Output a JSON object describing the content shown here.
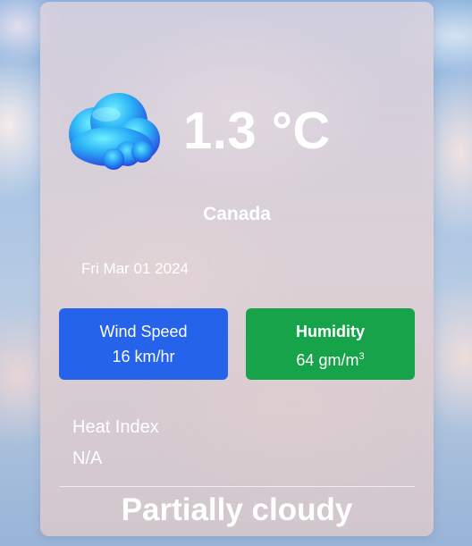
{
  "weather": {
    "temperature": "1.3 °C",
    "location": "Canada",
    "date": "Fri Mar 01 2024",
    "condition": "Partially cloudy",
    "icon": "cloud-icon"
  },
  "wind": {
    "label": "Wind Speed",
    "value": "16 km/hr",
    "color": "#2563eb"
  },
  "humidity": {
    "label": "Humidity",
    "value": "64 gm/m",
    "unit_exponent": "3",
    "color": "#16a34a"
  },
  "heat_index": {
    "label": "Heat Index",
    "value": "N/A"
  }
}
